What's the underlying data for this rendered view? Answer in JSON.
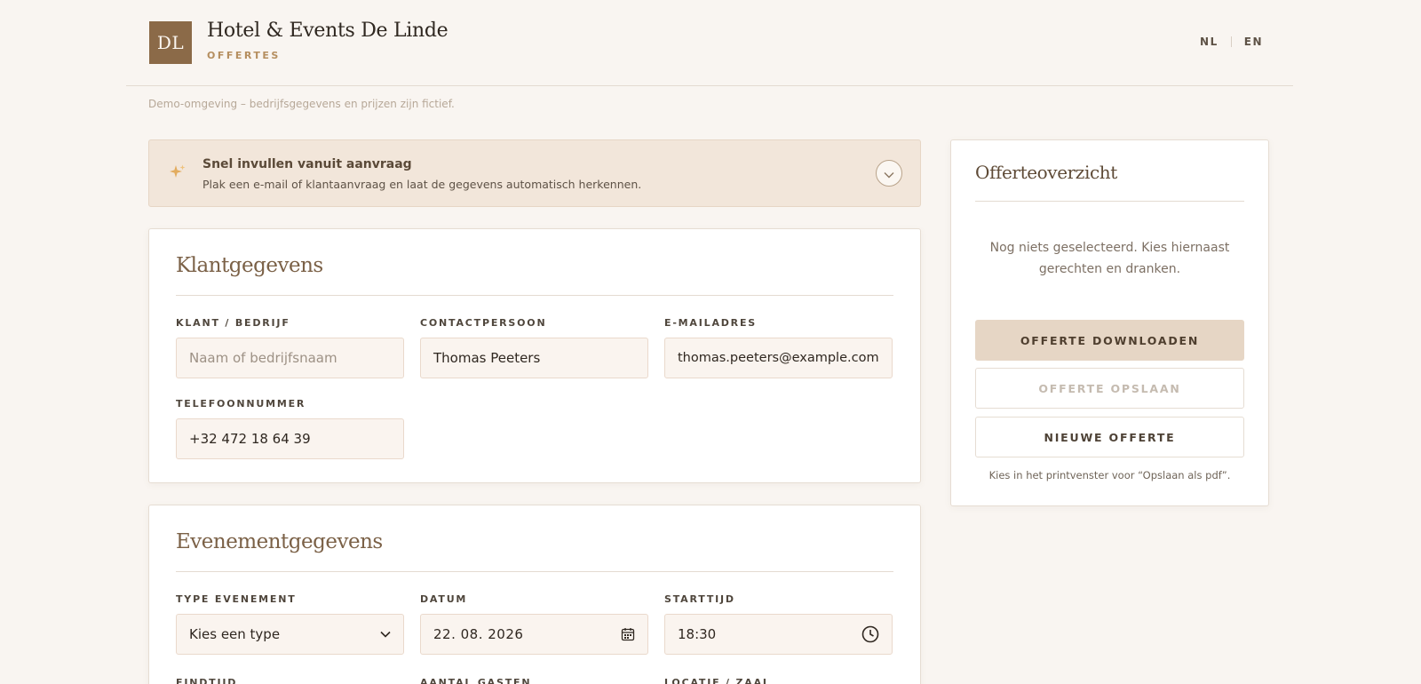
{
  "header": {
    "logo_text": "DL",
    "brand_name": "Hotel & Events De Linde",
    "brand_sub": "OFFERTES",
    "languages": [
      "NL",
      "EN"
    ]
  },
  "demo_note": "Demo-omgeving – bedrijfsgegevens en prijzen zijn fictief.",
  "quickfill": {
    "title": "Snel invullen vanuit aanvraag",
    "description": "Plak een e-mail of klantaanvraag en laat de gegevens automatisch herkennen.",
    "icon": "sparkle-icon",
    "toggle_icon": "chevron-down-icon"
  },
  "client": {
    "title": "Klantgegevens",
    "company_label": "KLANT / BEDRIJF",
    "company_value": "",
    "company_placeholder": "Naam of bedrijfsnaam",
    "contact_label": "CONTACTPERSOON",
    "contact_value": "Thomas Peeters",
    "email_label": "E-MAILADRES",
    "email_value": "thomas.peeters@example.com",
    "phone_label": "TELEFOONNUMMER",
    "phone_value": "+32 472 18 64 39"
  },
  "event": {
    "title": "Evenementgegevens",
    "type_label": "TYPE EVENEMENT",
    "type_value": "Kies een type",
    "date_label": "DATUM",
    "date_value": "22. 08. 2026",
    "start_label": "STARTTIJD",
    "start_value": "18:30",
    "end_label": "EINDTIJD",
    "guests_label": "AANTAL GASTEN",
    "location_label": "LOCATIE / ZAAL"
  },
  "summary": {
    "title": "Offerteoverzicht",
    "empty_text": "Nog niets geselecteerd. Kies hiernaast gerechten en dranken.",
    "download_label": "OFFERTE DOWNLOADEN",
    "save_label": "OFFERTE OPSLAAN",
    "new_label": "NIEUWE OFFERTE",
    "hint": "Kies in het printvenster voor “Opslaan als pdf”."
  },
  "colors": {
    "accent": "#8b6a48",
    "background": "#f9f5f1",
    "primary_button": "#e6d6c5"
  }
}
